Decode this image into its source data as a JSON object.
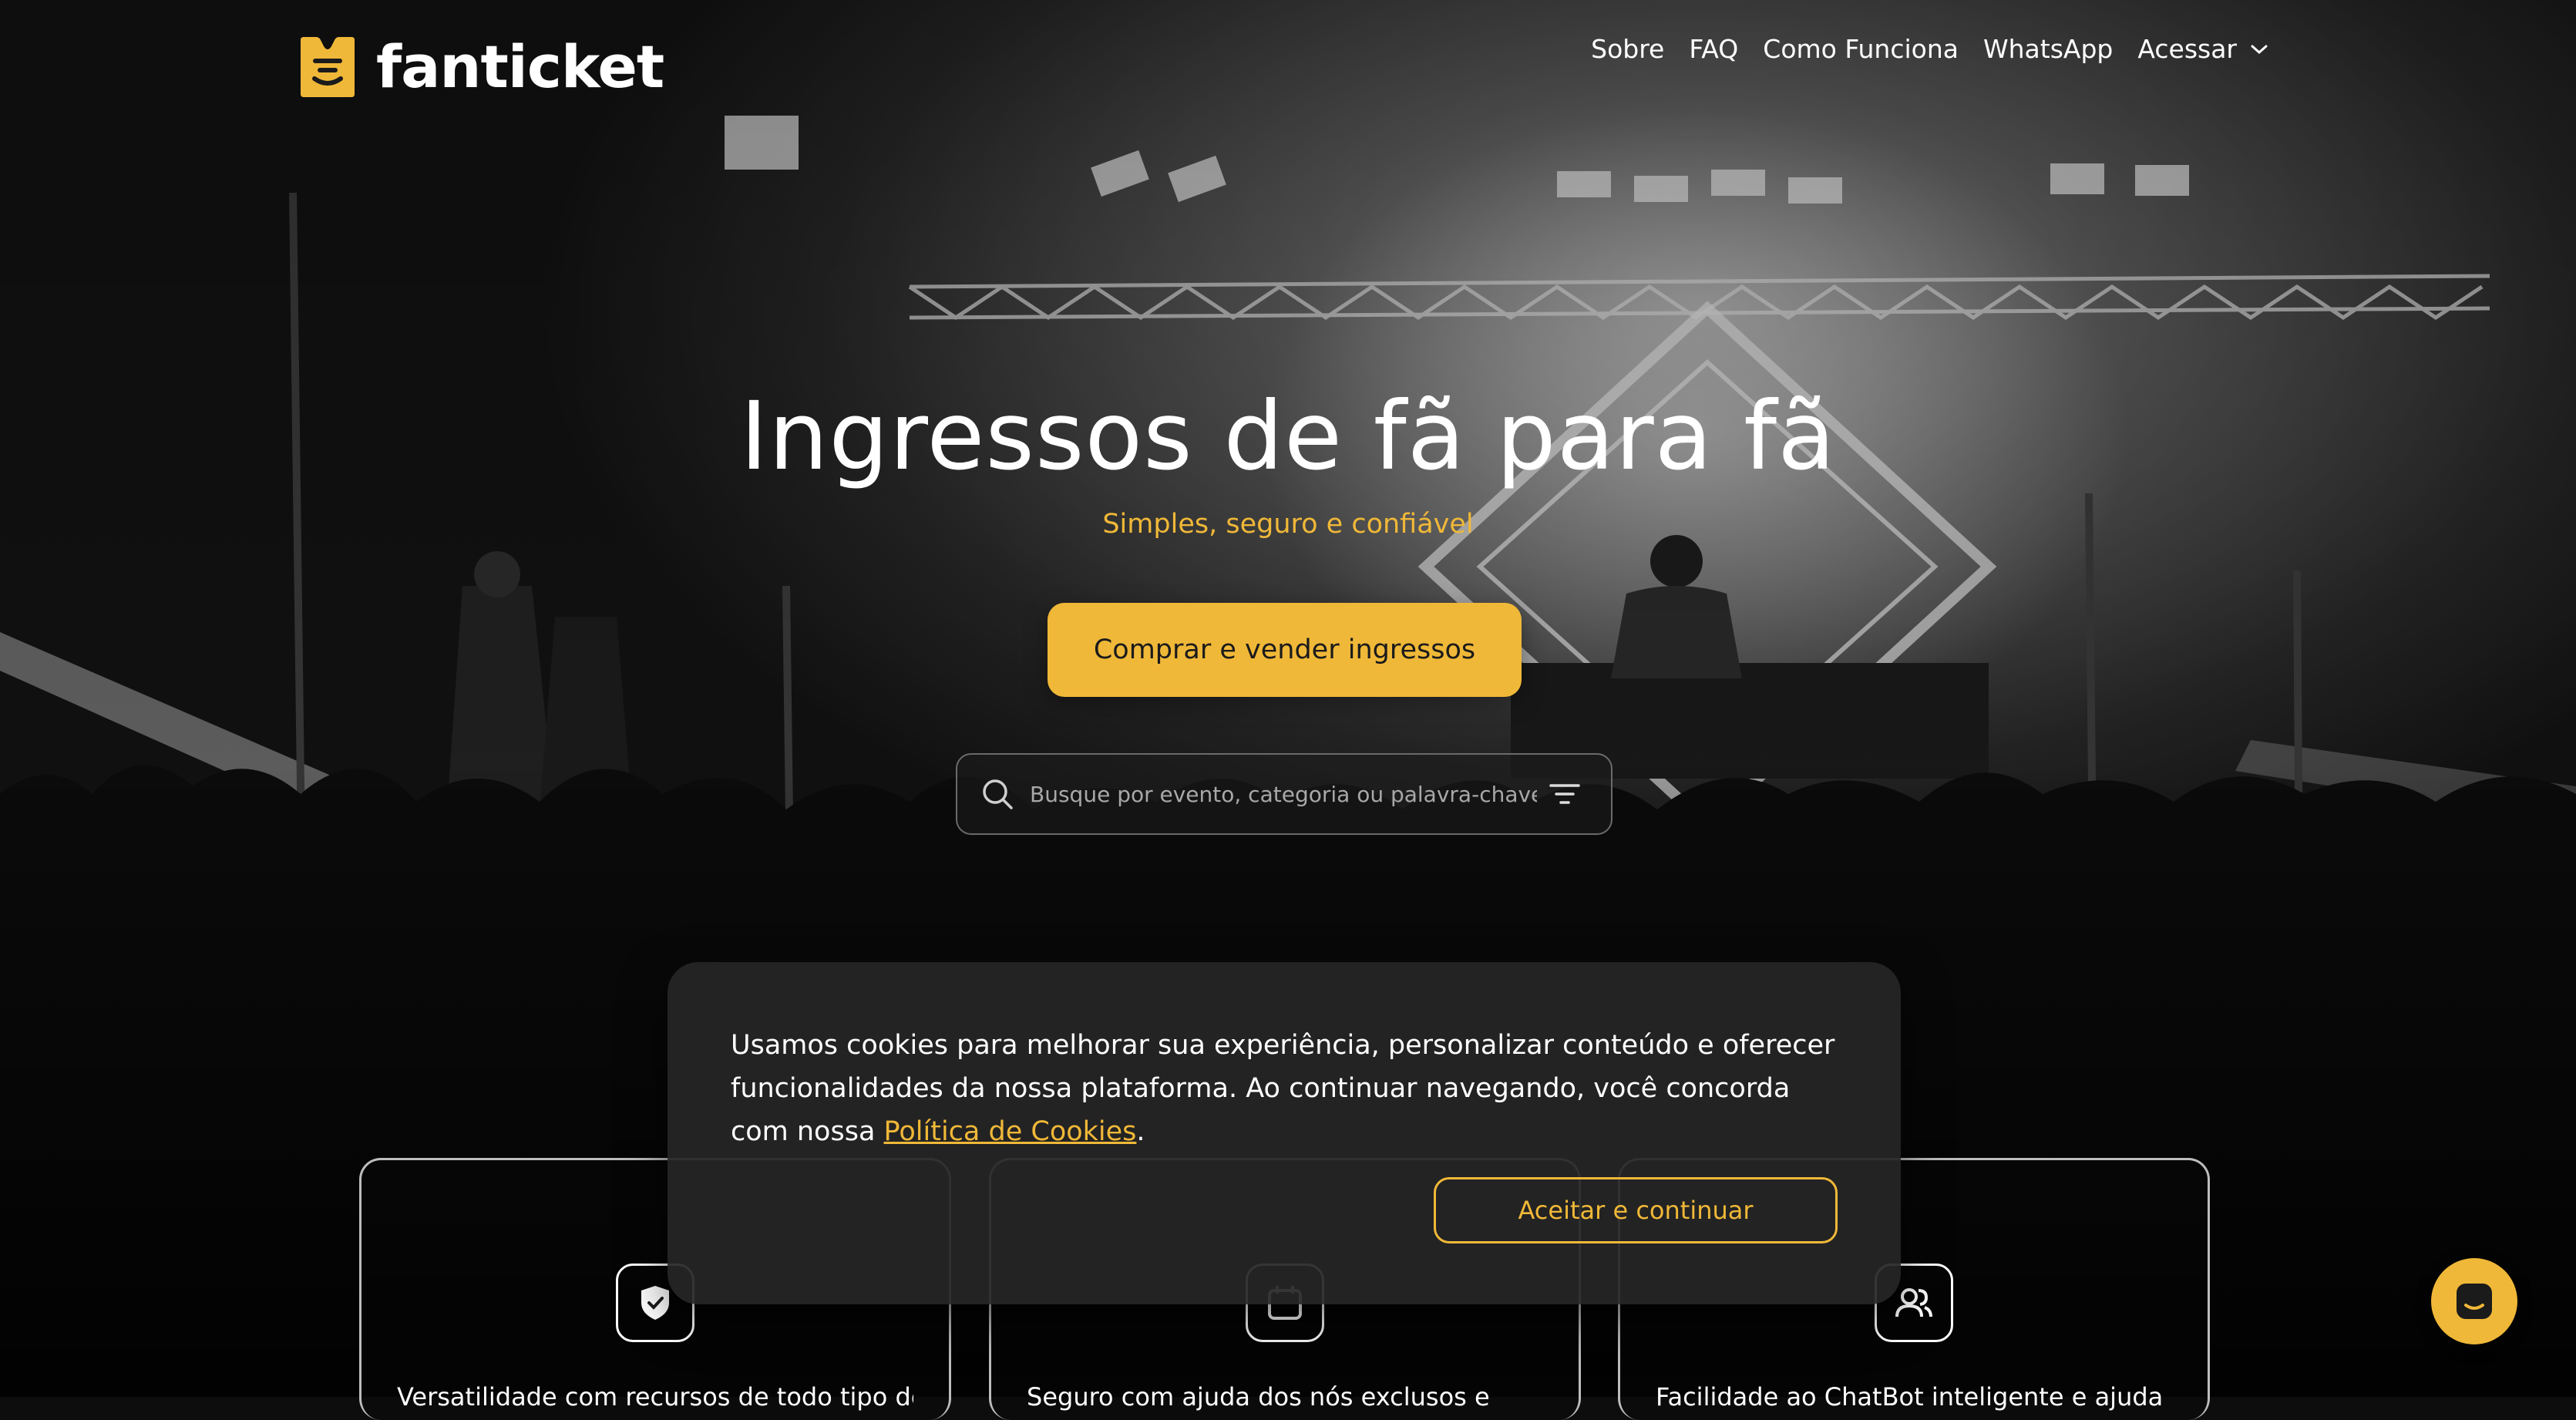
{
  "brand": {
    "name": "fanticket",
    "accent": "#f0b838"
  },
  "nav": {
    "items": [
      "Sobre",
      "FAQ",
      "Como Funciona",
      "WhatsApp"
    ],
    "login_label": "Acessar"
  },
  "hero": {
    "title": "Ingressos de fã para fã",
    "subtitle": "Simples, seguro e confiável",
    "cta_label": "Comprar e vender ingressos"
  },
  "search": {
    "placeholder": "Busque por evento, categoria ou palavra-chave",
    "value": ""
  },
  "features": [
    {
      "icon": "shield-check-icon",
      "text": "Versatilidade com recursos de todo tipo de"
    },
    {
      "icon": "calendar-icon",
      "text": "Seguro com ajuda dos nós exclusos e"
    },
    {
      "icon": "users-icon",
      "text": "Facilidade ao ChatBot inteligente e ajuda"
    }
  ],
  "cookie": {
    "message_line_1": "Usamos cookies para melhorar sua experiência, personalizar conteúdo e oferecer",
    "message_line_2": "funcionalidades da nossa plataforma. Ao continuar navegando, você concorda",
    "message_prefix": "com nossa ",
    "link_label": "Política de Cookies",
    "message_suffix": ".",
    "accept_label": "Aceitar e continuar"
  },
  "chat": {
    "icon": "chat-icon"
  }
}
